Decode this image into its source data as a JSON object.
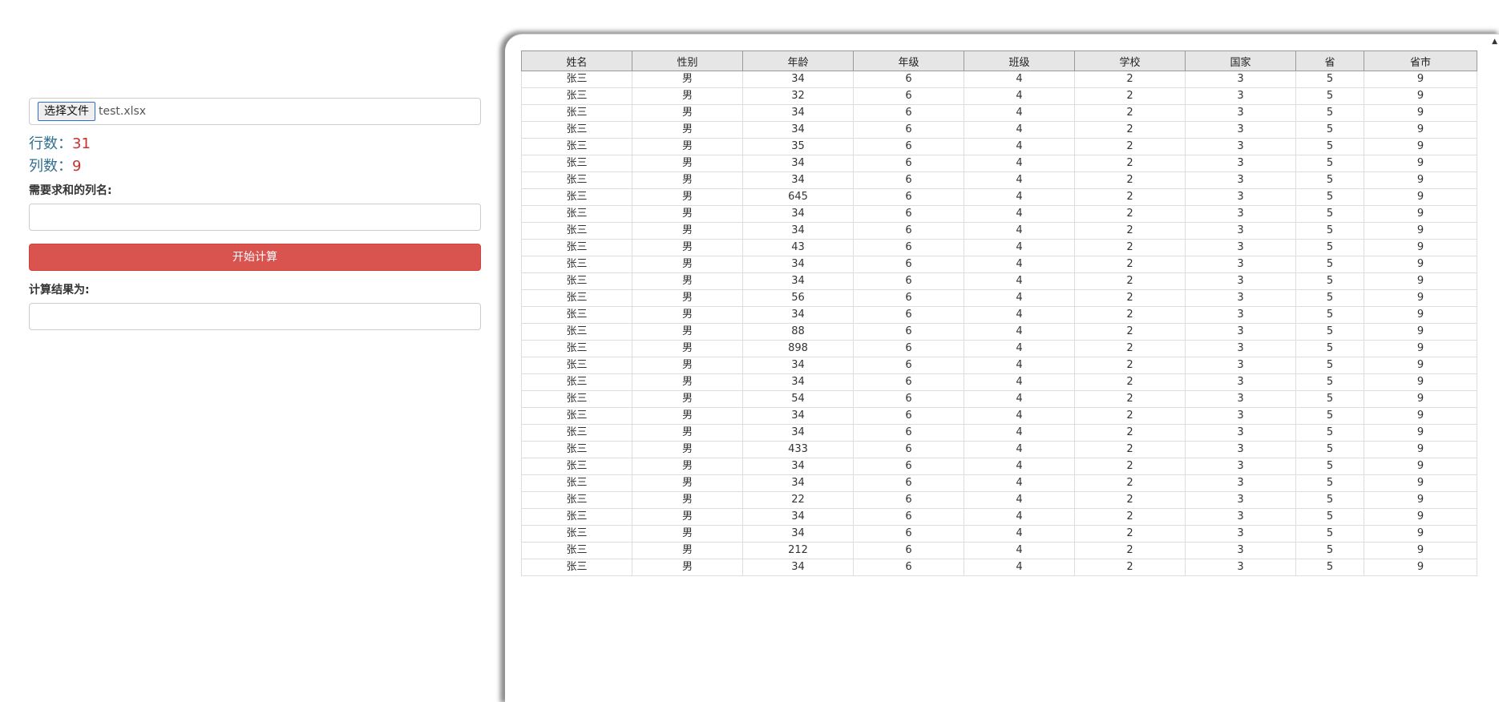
{
  "left": {
    "file_button_label": "选择文件",
    "file_name": "test.xlsx",
    "rows_label": "行数：",
    "rows_value": "31",
    "cols_label": "列数：",
    "cols_value": "9",
    "sum_column_label": "需要求和的列名:",
    "sum_column_value": "",
    "calc_button_label": "开始计算",
    "result_label": "计算结果为:",
    "result_value": ""
  },
  "table": {
    "headers": [
      "姓名",
      "性别",
      "年龄",
      "年级",
      "班级",
      "学校",
      "国家",
      "省",
      "省市"
    ],
    "rows": [
      [
        "张三",
        "男",
        "34",
        "6",
        "4",
        "2",
        "3",
        "5",
        "9"
      ],
      [
        "张三",
        "男",
        "32",
        "6",
        "4",
        "2",
        "3",
        "5",
        "9"
      ],
      [
        "张三",
        "男",
        "34",
        "6",
        "4",
        "2",
        "3",
        "5",
        "9"
      ],
      [
        "张三",
        "男",
        "34",
        "6",
        "4",
        "2",
        "3",
        "5",
        "9"
      ],
      [
        "张三",
        "男",
        "35",
        "6",
        "4",
        "2",
        "3",
        "5",
        "9"
      ],
      [
        "张三",
        "男",
        "34",
        "6",
        "4",
        "2",
        "3",
        "5",
        "9"
      ],
      [
        "张三",
        "男",
        "34",
        "6",
        "4",
        "2",
        "3",
        "5",
        "9"
      ],
      [
        "张三",
        "男",
        "645",
        "6",
        "4",
        "2",
        "3",
        "5",
        "9"
      ],
      [
        "张三",
        "男",
        "34",
        "6",
        "4",
        "2",
        "3",
        "5",
        "9"
      ],
      [
        "张三",
        "男",
        "34",
        "6",
        "4",
        "2",
        "3",
        "5",
        "9"
      ],
      [
        "张三",
        "男",
        "43",
        "6",
        "4",
        "2",
        "3",
        "5",
        "9"
      ],
      [
        "张三",
        "男",
        "34",
        "6",
        "4",
        "2",
        "3",
        "5",
        "9"
      ],
      [
        "张三",
        "男",
        "34",
        "6",
        "4",
        "2",
        "3",
        "5",
        "9"
      ],
      [
        "张三",
        "男",
        "56",
        "6",
        "4",
        "2",
        "3",
        "5",
        "9"
      ],
      [
        "张三",
        "男",
        "34",
        "6",
        "4",
        "2",
        "3",
        "5",
        "9"
      ],
      [
        "张三",
        "男",
        "88",
        "6",
        "4",
        "2",
        "3",
        "5",
        "9"
      ],
      [
        "张三",
        "男",
        "898",
        "6",
        "4",
        "2",
        "3",
        "5",
        "9"
      ],
      [
        "张三",
        "男",
        "34",
        "6",
        "4",
        "2",
        "3",
        "5",
        "9"
      ],
      [
        "张三",
        "男",
        "34",
        "6",
        "4",
        "2",
        "3",
        "5",
        "9"
      ],
      [
        "张三",
        "男",
        "54",
        "6",
        "4",
        "2",
        "3",
        "5",
        "9"
      ],
      [
        "张三",
        "男",
        "34",
        "6",
        "4",
        "2",
        "3",
        "5",
        "9"
      ],
      [
        "张三",
        "男",
        "34",
        "6",
        "4",
        "2",
        "3",
        "5",
        "9"
      ],
      [
        "张三",
        "男",
        "433",
        "6",
        "4",
        "2",
        "3",
        "5",
        "9"
      ],
      [
        "张三",
        "男",
        "34",
        "6",
        "4",
        "2",
        "3",
        "5",
        "9"
      ],
      [
        "张三",
        "男",
        "34",
        "6",
        "4",
        "2",
        "3",
        "5",
        "9"
      ],
      [
        "张三",
        "男",
        "22",
        "6",
        "4",
        "2",
        "3",
        "5",
        "9"
      ],
      [
        "张三",
        "男",
        "34",
        "6",
        "4",
        "2",
        "3",
        "5",
        "9"
      ],
      [
        "张三",
        "男",
        "34",
        "6",
        "4",
        "2",
        "3",
        "5",
        "9"
      ],
      [
        "张三",
        "男",
        "212",
        "6",
        "4",
        "2",
        "3",
        "5",
        "9"
      ],
      [
        "张三",
        "男",
        "34",
        "6",
        "4",
        "2",
        "3",
        "5",
        "9"
      ]
    ]
  },
  "colors": {
    "primary_danger": "#d9534f",
    "stat_label": "#31708f",
    "stat_value": "#c9302c",
    "header_bg": "#e6e6e6"
  }
}
